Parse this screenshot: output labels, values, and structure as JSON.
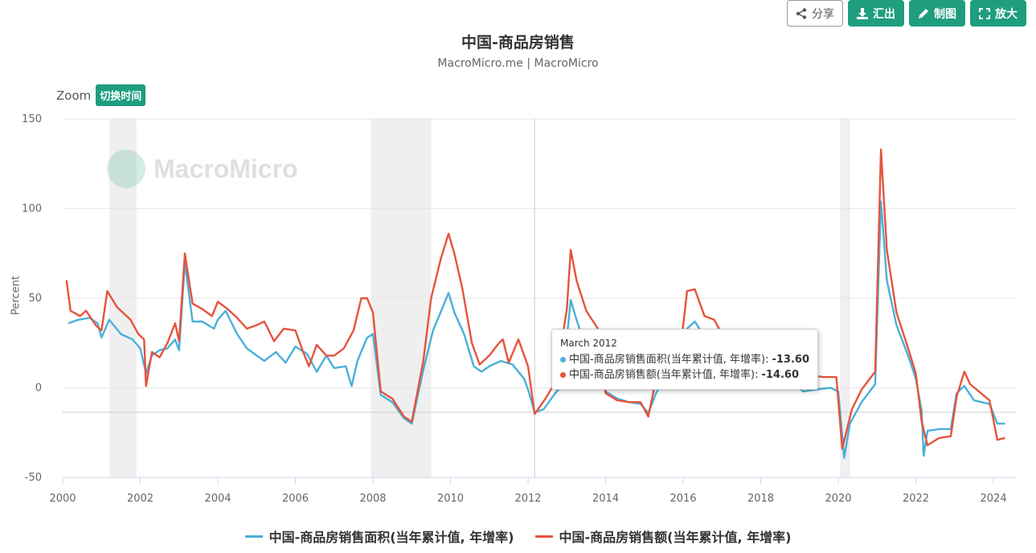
{
  "toolbar": {
    "share_label": "分享",
    "export_label": "汇出",
    "draw_label": "制图",
    "zoom_label": "放大"
  },
  "zoom": {
    "label": "Zoom",
    "toggle_label": "切换时间"
  },
  "watermark": {
    "text": "MacroMicro"
  },
  "tooltip": {
    "header": "March 2012",
    "rows": [
      {
        "label": "中国-商品房销售面积(当年累计值, 年增率):",
        "value": "-13.60"
      },
      {
        "label": "中国-商品房销售额(当年累计值, 年增率):",
        "value": "-14.60"
      }
    ]
  },
  "chart_data": {
    "type": "line",
    "title": "中国-商品房销售",
    "subtitle": "MacroMicro.me | MacroMicro",
    "ylabel": "Percent",
    "xlabel": "",
    "ylim": [
      -50,
      150
    ],
    "xlim": [
      2000,
      2024.6
    ],
    "yticks": [
      "150",
      "100",
      "50",
      "0",
      "-50"
    ],
    "xticks": [
      "2000",
      "2002",
      "2004",
      "2006",
      "2008",
      "2010",
      "2012",
      "2014",
      "2016",
      "2018",
      "2020",
      "2022",
      "2024"
    ],
    "shaded_periods": [
      [
        2001.2,
        2001.9
      ],
      [
        2007.95,
        2009.5
      ],
      [
        2020.05,
        2020.3
      ]
    ],
    "crosshair_x": 2012.17,
    "hline_y": -13.6,
    "grid": true,
    "legend_position": "bottom",
    "colors": {
      "area": "#4ab0d9",
      "amount": "#e5533d"
    },
    "series": [
      {
        "name": "中国-商品房销售面积(当年累计值, 年增率)",
        "color": "#4ab0d9",
        "points": [
          [
            2000.15,
            36
          ],
          [
            2000.4,
            38
          ],
          [
            2000.7,
            39
          ],
          [
            2000.9,
            36
          ],
          [
            2001.0,
            28
          ],
          [
            2001.2,
            38
          ],
          [
            2001.5,
            30
          ],
          [
            2001.8,
            27
          ],
          [
            2002.0,
            22
          ],
          [
            2002.15,
            8
          ],
          [
            2002.3,
            18
          ],
          [
            2002.5,
            21
          ],
          [
            2002.7,
            22
          ],
          [
            2002.9,
            27
          ],
          [
            2003.0,
            21
          ],
          [
            2003.15,
            70
          ],
          [
            2003.35,
            37
          ],
          [
            2003.6,
            37
          ],
          [
            2003.9,
            33
          ],
          [
            2004.0,
            38
          ],
          [
            2004.2,
            43
          ],
          [
            2004.5,
            30
          ],
          [
            2004.75,
            22
          ],
          [
            2005.0,
            18
          ],
          [
            2005.2,
            15
          ],
          [
            2005.5,
            20
          ],
          [
            2005.75,
            14
          ],
          [
            2006.0,
            23
          ],
          [
            2006.3,
            19
          ],
          [
            2006.55,
            9
          ],
          [
            2006.8,
            18
          ],
          [
            2007.0,
            11
          ],
          [
            2007.3,
            12
          ],
          [
            2007.45,
            1
          ],
          [
            2007.6,
            15
          ],
          [
            2007.85,
            28
          ],
          [
            2008.0,
            30
          ],
          [
            2008.2,
            -4
          ],
          [
            2008.5,
            -8
          ],
          [
            2008.8,
            -17
          ],
          [
            2009.0,
            -20
          ],
          [
            2009.3,
            10
          ],
          [
            2009.55,
            32
          ],
          [
            2009.8,
            45
          ],
          [
            2009.95,
            53
          ],
          [
            2010.1,
            42
          ],
          [
            2010.35,
            30
          ],
          [
            2010.6,
            12
          ],
          [
            2010.8,
            9
          ],
          [
            2011.0,
            12
          ],
          [
            2011.3,
            15
          ],
          [
            2011.6,
            13
          ],
          [
            2011.9,
            5
          ],
          [
            2012.0,
            -1
          ],
          [
            2012.17,
            -13.6
          ],
          [
            2012.4,
            -12
          ],
          [
            2012.7,
            -3
          ],
          [
            2012.95,
            3
          ],
          [
            2013.0,
            28
          ],
          [
            2013.1,
            49
          ],
          [
            2013.25,
            38
          ],
          [
            2013.5,
            22
          ],
          [
            2013.8,
            14
          ],
          [
            2014.0,
            -2
          ],
          [
            2014.3,
            -6
          ],
          [
            2014.6,
            -8
          ],
          [
            2014.9,
            -9
          ],
          [
            2015.1,
            -14
          ],
          [
            2015.3,
            -3
          ],
          [
            2015.6,
            8
          ],
          [
            2015.9,
            7
          ],
          [
            2016.1,
            33
          ],
          [
            2016.3,
            37
          ],
          [
            2016.6,
            27
          ],
          [
            2016.9,
            21
          ],
          [
            2017.1,
            16
          ],
          [
            2017.5,
            16
          ],
          [
            2017.9,
            8
          ],
          [
            2018.2,
            4
          ],
          [
            2018.6,
            3
          ],
          [
            2018.9,
            1
          ],
          [
            2019.1,
            -2
          ],
          [
            2019.4,
            -1
          ],
          [
            2019.8,
            0
          ],
          [
            2020.0,
            -2
          ],
          [
            2020.15,
            -39
          ],
          [
            2020.3,
            -20
          ],
          [
            2020.6,
            -8
          ],
          [
            2020.95,
            2
          ],
          [
            2021.1,
            104
          ],
          [
            2021.25,
            60
          ],
          [
            2021.5,
            35
          ],
          [
            2021.8,
            18
          ],
          [
            2022.0,
            5
          ],
          [
            2022.15,
            -13
          ],
          [
            2022.2,
            -38
          ],
          [
            2022.3,
            -24
          ],
          [
            2022.6,
            -23
          ],
          [
            2022.9,
            -23
          ],
          [
            2023.05,
            -3
          ],
          [
            2023.25,
            1
          ],
          [
            2023.5,
            -7
          ],
          [
            2023.9,
            -9
          ],
          [
            2024.1,
            -20
          ],
          [
            2024.3,
            -20
          ]
        ]
      },
      {
        "name": "中国-商品房销售额(当年累计值, 年增率)",
        "color": "#e5533d",
        "points": [
          [
            2000.1,
            60
          ],
          [
            2000.2,
            43
          ],
          [
            2000.45,
            40
          ],
          [
            2000.6,
            43
          ],
          [
            2000.85,
            35
          ],
          [
            2001.0,
            32
          ],
          [
            2001.15,
            54
          ],
          [
            2001.4,
            45
          ],
          [
            2001.75,
            38
          ],
          [
            2001.95,
            30
          ],
          [
            2002.1,
            27
          ],
          [
            2002.15,
            1
          ],
          [
            2002.3,
            20
          ],
          [
            2002.5,
            17
          ],
          [
            2002.7,
            25
          ],
          [
            2002.9,
            36
          ],
          [
            2003.0,
            26
          ],
          [
            2003.15,
            75
          ],
          [
            2003.35,
            47
          ],
          [
            2003.6,
            44
          ],
          [
            2003.85,
            40
          ],
          [
            2004.0,
            48
          ],
          [
            2004.25,
            44
          ],
          [
            2004.5,
            39
          ],
          [
            2004.75,
            33
          ],
          [
            2005.0,
            35
          ],
          [
            2005.2,
            37
          ],
          [
            2005.45,
            26
          ],
          [
            2005.7,
            33
          ],
          [
            2006.0,
            32
          ],
          [
            2006.2,
            20
          ],
          [
            2006.35,
            12
          ],
          [
            2006.55,
            24
          ],
          [
            2006.8,
            18
          ],
          [
            2007.0,
            18
          ],
          [
            2007.25,
            22
          ],
          [
            2007.5,
            32
          ],
          [
            2007.7,
            50
          ],
          [
            2007.85,
            50
          ],
          [
            2008.0,
            42
          ],
          [
            2008.2,
            -2
          ],
          [
            2008.5,
            -6
          ],
          [
            2008.8,
            -16
          ],
          [
            2009.0,
            -19
          ],
          [
            2009.3,
            15
          ],
          [
            2009.5,
            50
          ],
          [
            2009.75,
            72
          ],
          [
            2009.95,
            86
          ],
          [
            2010.1,
            75
          ],
          [
            2010.3,
            56
          ],
          [
            2010.55,
            25
          ],
          [
            2010.75,
            13
          ],
          [
            2011.0,
            18
          ],
          [
            2011.25,
            25
          ],
          [
            2011.35,
            27
          ],
          [
            2011.5,
            14
          ],
          [
            2011.75,
            27
          ],
          [
            2012.0,
            12
          ],
          [
            2012.17,
            -14.6
          ],
          [
            2012.45,
            -6
          ],
          [
            2012.7,
            3
          ],
          [
            2013.0,
            44
          ],
          [
            2013.1,
            77
          ],
          [
            2013.25,
            60
          ],
          [
            2013.5,
            43
          ],
          [
            2013.8,
            33
          ],
          [
            2014.0,
            -3
          ],
          [
            2014.3,
            -7
          ],
          [
            2014.6,
            -8
          ],
          [
            2014.9,
            -8
          ],
          [
            2015.1,
            -16
          ],
          [
            2015.3,
            5
          ],
          [
            2015.6,
            18
          ],
          [
            2015.9,
            16
          ],
          [
            2016.1,
            54
          ],
          [
            2016.3,
            55
          ],
          [
            2016.55,
            40
          ],
          [
            2016.8,
            38
          ],
          [
            2017.0,
            30
          ],
          [
            2017.5,
            20
          ],
          [
            2017.9,
            13
          ],
          [
            2018.2,
            13
          ],
          [
            2018.6,
            12
          ],
          [
            2018.9,
            10
          ],
          [
            2019.3,
            7
          ],
          [
            2019.6,
            6
          ],
          [
            2019.95,
            6
          ],
          [
            2020.1,
            -34
          ],
          [
            2020.35,
            -12
          ],
          [
            2020.6,
            -1
          ],
          [
            2020.95,
            9
          ],
          [
            2021.1,
            133
          ],
          [
            2021.25,
            77
          ],
          [
            2021.5,
            42
          ],
          [
            2021.8,
            22
          ],
          [
            2022.0,
            8
          ],
          [
            2022.15,
            -19
          ],
          [
            2022.3,
            -32
          ],
          [
            2022.6,
            -28
          ],
          [
            2022.9,
            -27
          ],
          [
            2023.05,
            -5
          ],
          [
            2023.25,
            9
          ],
          [
            2023.4,
            2
          ],
          [
            2023.9,
            -7
          ],
          [
            2024.1,
            -29
          ],
          [
            2024.3,
            -28
          ]
        ]
      }
    ]
  }
}
